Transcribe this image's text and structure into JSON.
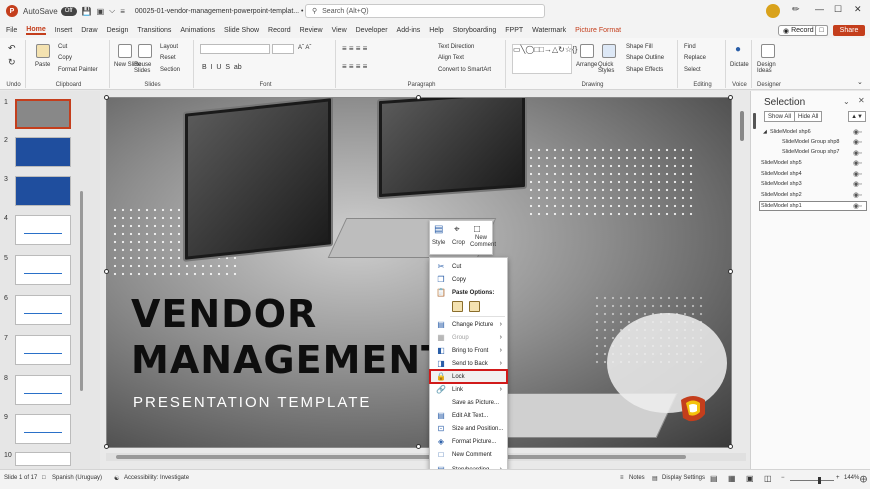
{
  "titlebar": {
    "autosave_label": "AutoSave",
    "autosave_state": "Off",
    "doc_title": "00025-01-vendor-management-powerpoint-templat... •",
    "search_placeholder": "Search (Alt+Q)"
  },
  "menu": [
    "File",
    "Home",
    "Insert",
    "Draw",
    "Design",
    "Transitions",
    "Animations",
    "Slide Show",
    "Record",
    "Review",
    "View",
    "Developer",
    "Add-ins",
    "Help",
    "Storyboarding",
    "FPPT",
    "Watermark",
    "Picture Format"
  ],
  "header_buttons": {
    "record": "Record",
    "share": "Share"
  },
  "ribbon": {
    "groups": [
      "Undo",
      "Clipboard",
      "Slides",
      "Font",
      "Paragraph",
      "Drawing",
      "Editing",
      "Voice",
      "Designer"
    ],
    "clipboard": {
      "paste": "Paste",
      "cut": "Cut",
      "copy": "Copy",
      "format_painter": "Format Painter"
    },
    "slides": {
      "new_slide": "New Slide",
      "reuse_slides": "Reuse Slides",
      "layout": "Layout",
      "reset": "Reset",
      "section": "Section"
    },
    "paragraph": {
      "text_direction": "Text Direction",
      "align_text": "Align Text",
      "convert_smartart": "Convert to SmartArt"
    },
    "drawing": {
      "arrange": "Arrange",
      "quick_styles": "Quick Styles",
      "shape_fill": "Shape Fill",
      "shape_outline": "Shape Outline",
      "shape_effects": "Shape Effects"
    },
    "editing": {
      "find": "Find",
      "replace": "Replace",
      "select": "Select"
    },
    "voice": {
      "dictate": "Dictate"
    },
    "designer": {
      "design_ideas": "Design Ideas"
    }
  },
  "slides": {
    "numbers": [
      "1",
      "2",
      "3",
      "4",
      "5",
      "6",
      "7",
      "8",
      "9",
      "10"
    ]
  },
  "slide": {
    "title_line1": "VENDOR",
    "title_line2": "MANAGEMENT",
    "subtitle": "PRESENTATION TEMPLATE"
  },
  "mini_toolbar": {
    "style": "Style",
    "crop": "Crop",
    "new_comment": "New Comment"
  },
  "context_menu": {
    "cut": "Cut",
    "copy": "Copy",
    "paste_options": "Paste Options:",
    "change_picture": "Change Picture",
    "group": "Group",
    "bring_to_front": "Bring to Front",
    "send_to_back": "Send to Back",
    "lock": "Lock",
    "link": "Link",
    "save_as_picture": "Save as Picture...",
    "edit_alt_text": "Edit Alt Text...",
    "size_position": "Size and Position...",
    "format_picture": "Format Picture...",
    "new_comment": "New Comment",
    "storyboarding": "Storyboarding"
  },
  "selection_pane": {
    "title": "Selection",
    "show_all": "Show All",
    "hide_all": "Hide All",
    "items": [
      "SlideModel shp6",
      "SlideModel Group shp8",
      "SlideModel Group shp7",
      "SlideModel shp5",
      "SlideModel shp4",
      "SlideModel shp3",
      "SlideModel shp2",
      "SlideModel shp1"
    ]
  },
  "status": {
    "slide_info": "Slide 1 of 17",
    "language": "Spanish (Uruguay)",
    "accessibility": "Accessibility: Investigate",
    "notes": "Notes",
    "display_settings": "Display Settings",
    "zoom": "144%"
  },
  "colors": {
    "accent": "#c43e1c",
    "lock_highlight": "#d11a1a"
  }
}
